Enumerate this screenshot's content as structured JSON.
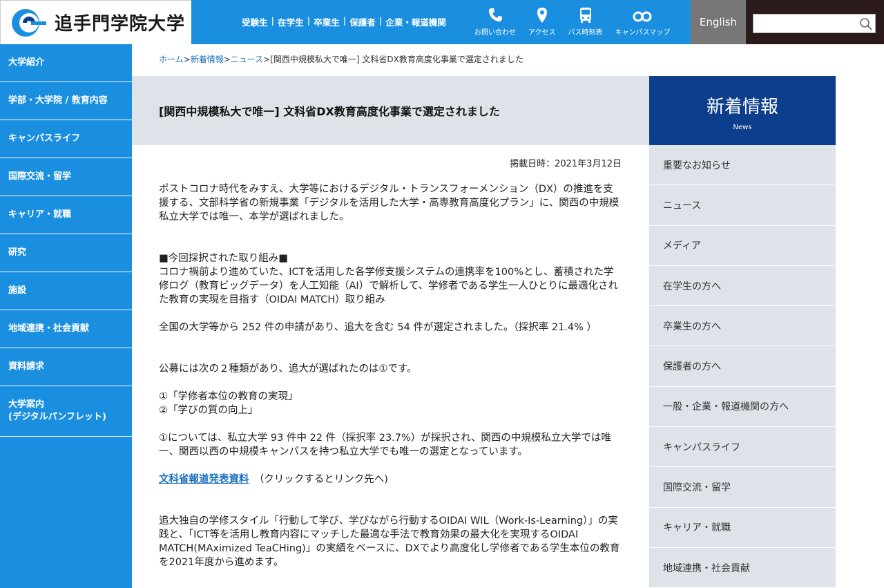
{
  "header": {
    "logo_text": "追手門学院大学",
    "top_nav": [
      "受験生",
      "在学生",
      "卒業生",
      "保護者",
      "企業・報道機関"
    ],
    "icons": [
      {
        "label": "お問い合わせ",
        "icon": "phone-icon"
      },
      {
        "label": "アクセス",
        "icon": "map-pin-icon"
      },
      {
        "label": "バス時刻表",
        "icon": "bus-icon"
      },
      {
        "label": "キャンパスマップ",
        "icon": "binoculars-icon"
      }
    ],
    "english_label": "English",
    "search_value": ""
  },
  "leftnav": [
    "大学紹介",
    "学部・大学院 / 教育内容",
    "キャンパスライフ",
    "国際交流・留学",
    "キャリア・就職",
    "研究",
    "施設",
    "地域連携・社会貢献",
    "資料請求",
    "大学案内\n(デジタルパンフレット)"
  ],
  "breadcrumb": {
    "home": "ホーム",
    "sep1": ">",
    "news_info": "新着情報",
    "sep2": ">",
    "news": "ニュース",
    "sep3": ">",
    "current": "[関西中規模私大で唯一] 文科省DX教育高度化事業で選定されました"
  },
  "article": {
    "title": "[関西中規模私大で唯一] 文科省DX教育高度化事業で選定されました",
    "date": "掲載日時：2021年3月12日",
    "p1": "ポストコロナ時代をみすえ、大学等におけるデジタル・トランスフォーメンション（DX）の推進を支援する、文部科学省の新規事業「デジタルを活用した大学・高専教育高度化プラン」に、関西の中規模私立大学では唯一、本学が選ばれました。",
    "p2_head": "■今回採択された取り組み■",
    "p2": "コロナ禍前より進めていた、ICTを活用した各学修支援システムの連携率を100%とし、蓄積された学修ログ（教育ビッグデータ）を人工知能（AI）で解析して、学修者である学生一人ひとりに最適化された教育の実現を目指す（OIDAI MATCH）取り組み",
    "p3": "全国の大学等から 252 件の申請があり、追大を含む 54 件が選定されました。（採択率 21.4% ）",
    "p4": "公募には次の２種類があり、追大が選ばれたのは①です。",
    "p5a": "①「学修者本位の教育の実現」",
    "p5b": "②「学びの質の向上」",
    "p6": "①については、私立大学 93 件中 22 件（採択率 23.7%）が採択され、関西の中規模私立大学では唯一、関西以西の中規模キャンパスを持つ私立大学でも唯一の選定となっています。",
    "link_text": "文科省報道発表資料",
    "link_note": "（クリックするとリンク先へ)",
    "p7": "追大独自の学修スタイル「行動して学び、学びながら行動するOIDAI WIL（Work-Is-Learning）」の実践と、「ICT等を活用し教育内容にマッチした最適な手法で教育効果の最大化を実現するOIDAI MATCH(MAximized TeaCHing)」の実績をベースに、DXでより高度化し学修者である学生本位の教育を2021年度から進めます。"
  },
  "rightnav": {
    "title": "新着情報",
    "subtitle": "News",
    "items": [
      "重要なお知らせ",
      "ニュース",
      "メディア",
      "在学生の方へ",
      "卒業生の方へ",
      "保護者の方へ",
      "一般・企業・報道機関の方へ",
      "キャンパスライフ",
      "国際交流・留学",
      "キャリア・就職",
      "地域連携・社会貢献"
    ]
  },
  "colors": {
    "primary_blue": "#1a8fe0",
    "navy": "#0c3e8c",
    "gray_band": "#dde3e8"
  }
}
